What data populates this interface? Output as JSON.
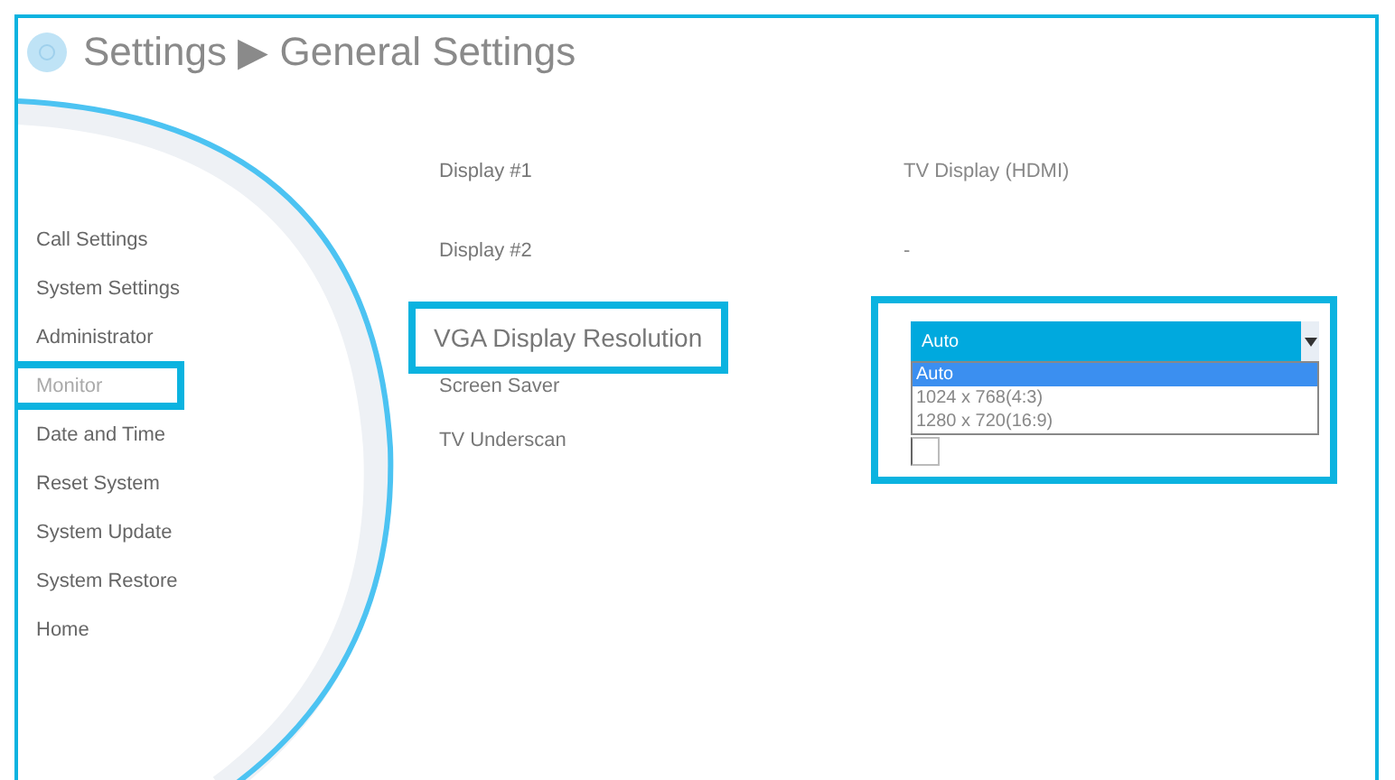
{
  "title": {
    "parent": "Settings",
    "separator": "▶",
    "current": "General Settings"
  },
  "sidebar": {
    "items": [
      {
        "label": "Call Settings",
        "selected": false,
        "highlighted": false
      },
      {
        "label": "System Settings",
        "selected": false,
        "highlighted": false
      },
      {
        "label": "Administrator",
        "selected": false,
        "highlighted": false
      },
      {
        "label": "Monitor",
        "selected": true,
        "highlighted": true
      },
      {
        "label": "Date and Time",
        "selected": false,
        "highlighted": false
      },
      {
        "label": "Reset System",
        "selected": false,
        "highlighted": false
      },
      {
        "label": "System Update",
        "selected": false,
        "highlighted": false
      },
      {
        "label": "System Restore",
        "selected": false,
        "highlighted": false
      },
      {
        "label": "Home",
        "selected": false,
        "highlighted": false
      }
    ]
  },
  "settings": [
    {
      "kind": "info",
      "label": "Display #1",
      "value": "TV Display (HDMI)"
    },
    {
      "kind": "info",
      "label": "Display #2",
      "value": "-"
    },
    {
      "kind": "dropdown",
      "label": "VGA Display Resolution",
      "highlighted": true,
      "value": "Auto",
      "expanded": true,
      "options": [
        {
          "label": "Auto",
          "selected": true
        },
        {
          "label": "1024 x 768(4:3)",
          "selected": false
        },
        {
          "label": "1280 x 720(16:9)",
          "selected": false
        }
      ]
    },
    {
      "kind": "plain",
      "label": "Screen Saver"
    },
    {
      "kind": "checkbox",
      "label": "TV Underscan",
      "checked": false
    }
  ]
}
